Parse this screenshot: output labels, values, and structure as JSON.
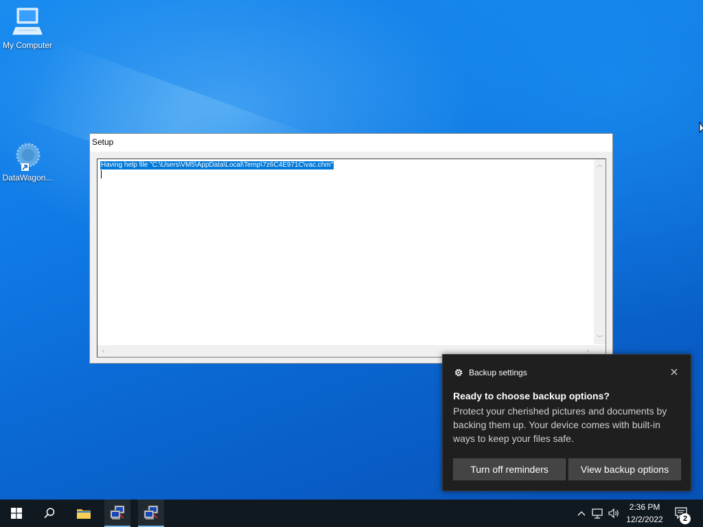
{
  "desktop": {
    "icons": [
      {
        "label": "My Computer"
      },
      {
        "label": "DataWagon..."
      }
    ]
  },
  "setup_window": {
    "title": "Setup",
    "text_selected": "Having help file \"C:\\Users\\VM5\\AppData\\Local\\Temp\\7z6C4E971C\\vac.chm\""
  },
  "notification": {
    "app_name": "Backup settings",
    "title": "Ready to choose backup options?",
    "body": "Protect your cherished pictures and documents by backing them up. Your device comes with built-in ways to keep your files safe.",
    "button_primary": "Turn off reminders",
    "button_secondary": "View backup options"
  },
  "taskbar": {
    "time": "2:36 PM",
    "date": "12/2/2022",
    "notification_count": "2"
  },
  "colors": {
    "selection": "#0078d7",
    "toast_bg": "#1f1f1f",
    "taskbar_bg": "#101820"
  }
}
